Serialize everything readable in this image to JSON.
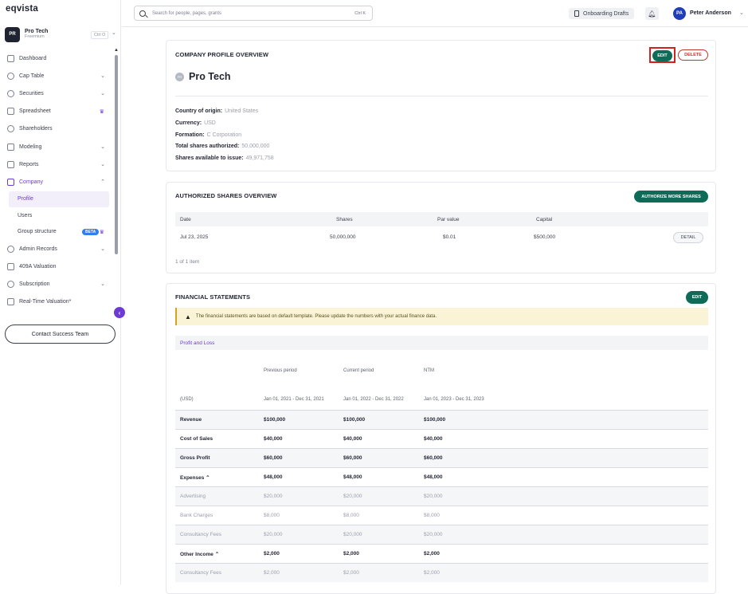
{
  "app": {
    "logo": "eqvista"
  },
  "company_switcher": {
    "avatar": "PR",
    "name": "Pro Tech",
    "plan": "Freemium",
    "shortcut": "Ctrl O"
  },
  "sidebar": {
    "items": [
      {
        "label": "Dashboard"
      },
      {
        "label": "Cap Table"
      },
      {
        "label": "Securities"
      },
      {
        "label": "Spreadsheet"
      },
      {
        "label": "Shareholders"
      },
      {
        "label": "Modeling"
      },
      {
        "label": "Reports"
      },
      {
        "label": "Company"
      },
      {
        "label": "Admin Records"
      },
      {
        "label": "409A Valuation"
      },
      {
        "label": "Subscription"
      },
      {
        "label": "Real-Time Valuation*"
      }
    ],
    "company_sub": [
      {
        "label": "Profile"
      },
      {
        "label": "Users"
      },
      {
        "label": "Group structure",
        "badge": "BETA"
      }
    ],
    "contact_label": "Contact Success Team"
  },
  "topbar": {
    "search_placeholder": "Search for people, pages, grants",
    "search_shortcut": "Ctrl K",
    "drafts_label": "Onboarding Drafts",
    "user_initials": "PA",
    "user_name": "Peter Anderson"
  },
  "profile": {
    "title": "COMPANY PROFILE OVERVIEW",
    "edit_label": "EDIT",
    "delete_label": "DELETE",
    "logo_initials": "PR",
    "company_name": "Pro Tech",
    "props": [
      {
        "label": "Country of origin:",
        "value": "United States"
      },
      {
        "label": "Currency:",
        "value": "USD"
      },
      {
        "label": "Formation:",
        "value": "C Corporation"
      },
      {
        "label": "Total shares authorized:",
        "value": "50,000,000"
      },
      {
        "label": "Shares available to issue:",
        "value": "49,971,758"
      }
    ]
  },
  "authorized": {
    "title": "AUTHORIZED SHARES OVERVIEW",
    "button_label": "AUTHORIZE MORE SHARES",
    "headers": [
      "Date",
      "Shares",
      "Par value",
      "Capital"
    ],
    "row": {
      "date": "Jul 23, 2025",
      "shares": "50,000,000",
      "par": "$0.01",
      "capital": "$500,000",
      "action": "DETAIL"
    },
    "pager": "1 of 1 item"
  },
  "financial": {
    "title": "FINANCIAL STATEMENTS",
    "edit_label": "EDIT",
    "banner": "The financial statements are based on default template. Please update the numbers with your actual finance data.",
    "section": "Profit and Loss",
    "columns": [
      "Previous period",
      "Current period",
      "NTM"
    ],
    "currency": "(USD)",
    "ranges": [
      "Jan 01, 2021 - Dec 31, 2021",
      "Jan 01, 2022 - Dec 31, 2022",
      "Jan 01, 2023 - Dec 31, 2023"
    ],
    "rows": [
      {
        "label": "Revenue",
        "v": [
          "$100,000",
          "$100,000",
          "$100,000"
        ]
      },
      {
        "label": "Cost of Sales",
        "v": [
          "$40,000",
          "$40,000",
          "$40,000"
        ]
      },
      {
        "label": "Gross Profit",
        "v": [
          "$60,000",
          "$60,000",
          "$60,000"
        ]
      },
      {
        "label": "Expenses ⌃",
        "v": [
          "$48,000",
          "$48,000",
          "$48,000"
        ]
      },
      {
        "label": "Advertising",
        "v": [
          "$20,000",
          "$20,000",
          "$20,000"
        ]
      },
      {
        "label": "Bank Charges",
        "v": [
          "$8,000",
          "$8,000",
          "$8,000"
        ]
      },
      {
        "label": "Consultancy Fees",
        "v": [
          "$20,000",
          "$20,000",
          "$20,000"
        ]
      },
      {
        "label": "Other Income ⌃",
        "v": [
          "$2,000",
          "$2,000",
          "$2,000"
        ]
      },
      {
        "label": "Consultancy Fees",
        "v": [
          "$2,000",
          "$2,000",
          "$2,000"
        ]
      }
    ]
  },
  "colors": {
    "brand_purple": "#6d3ad6",
    "primary_green": "#0d6b57",
    "danger_red": "#c0392b"
  }
}
